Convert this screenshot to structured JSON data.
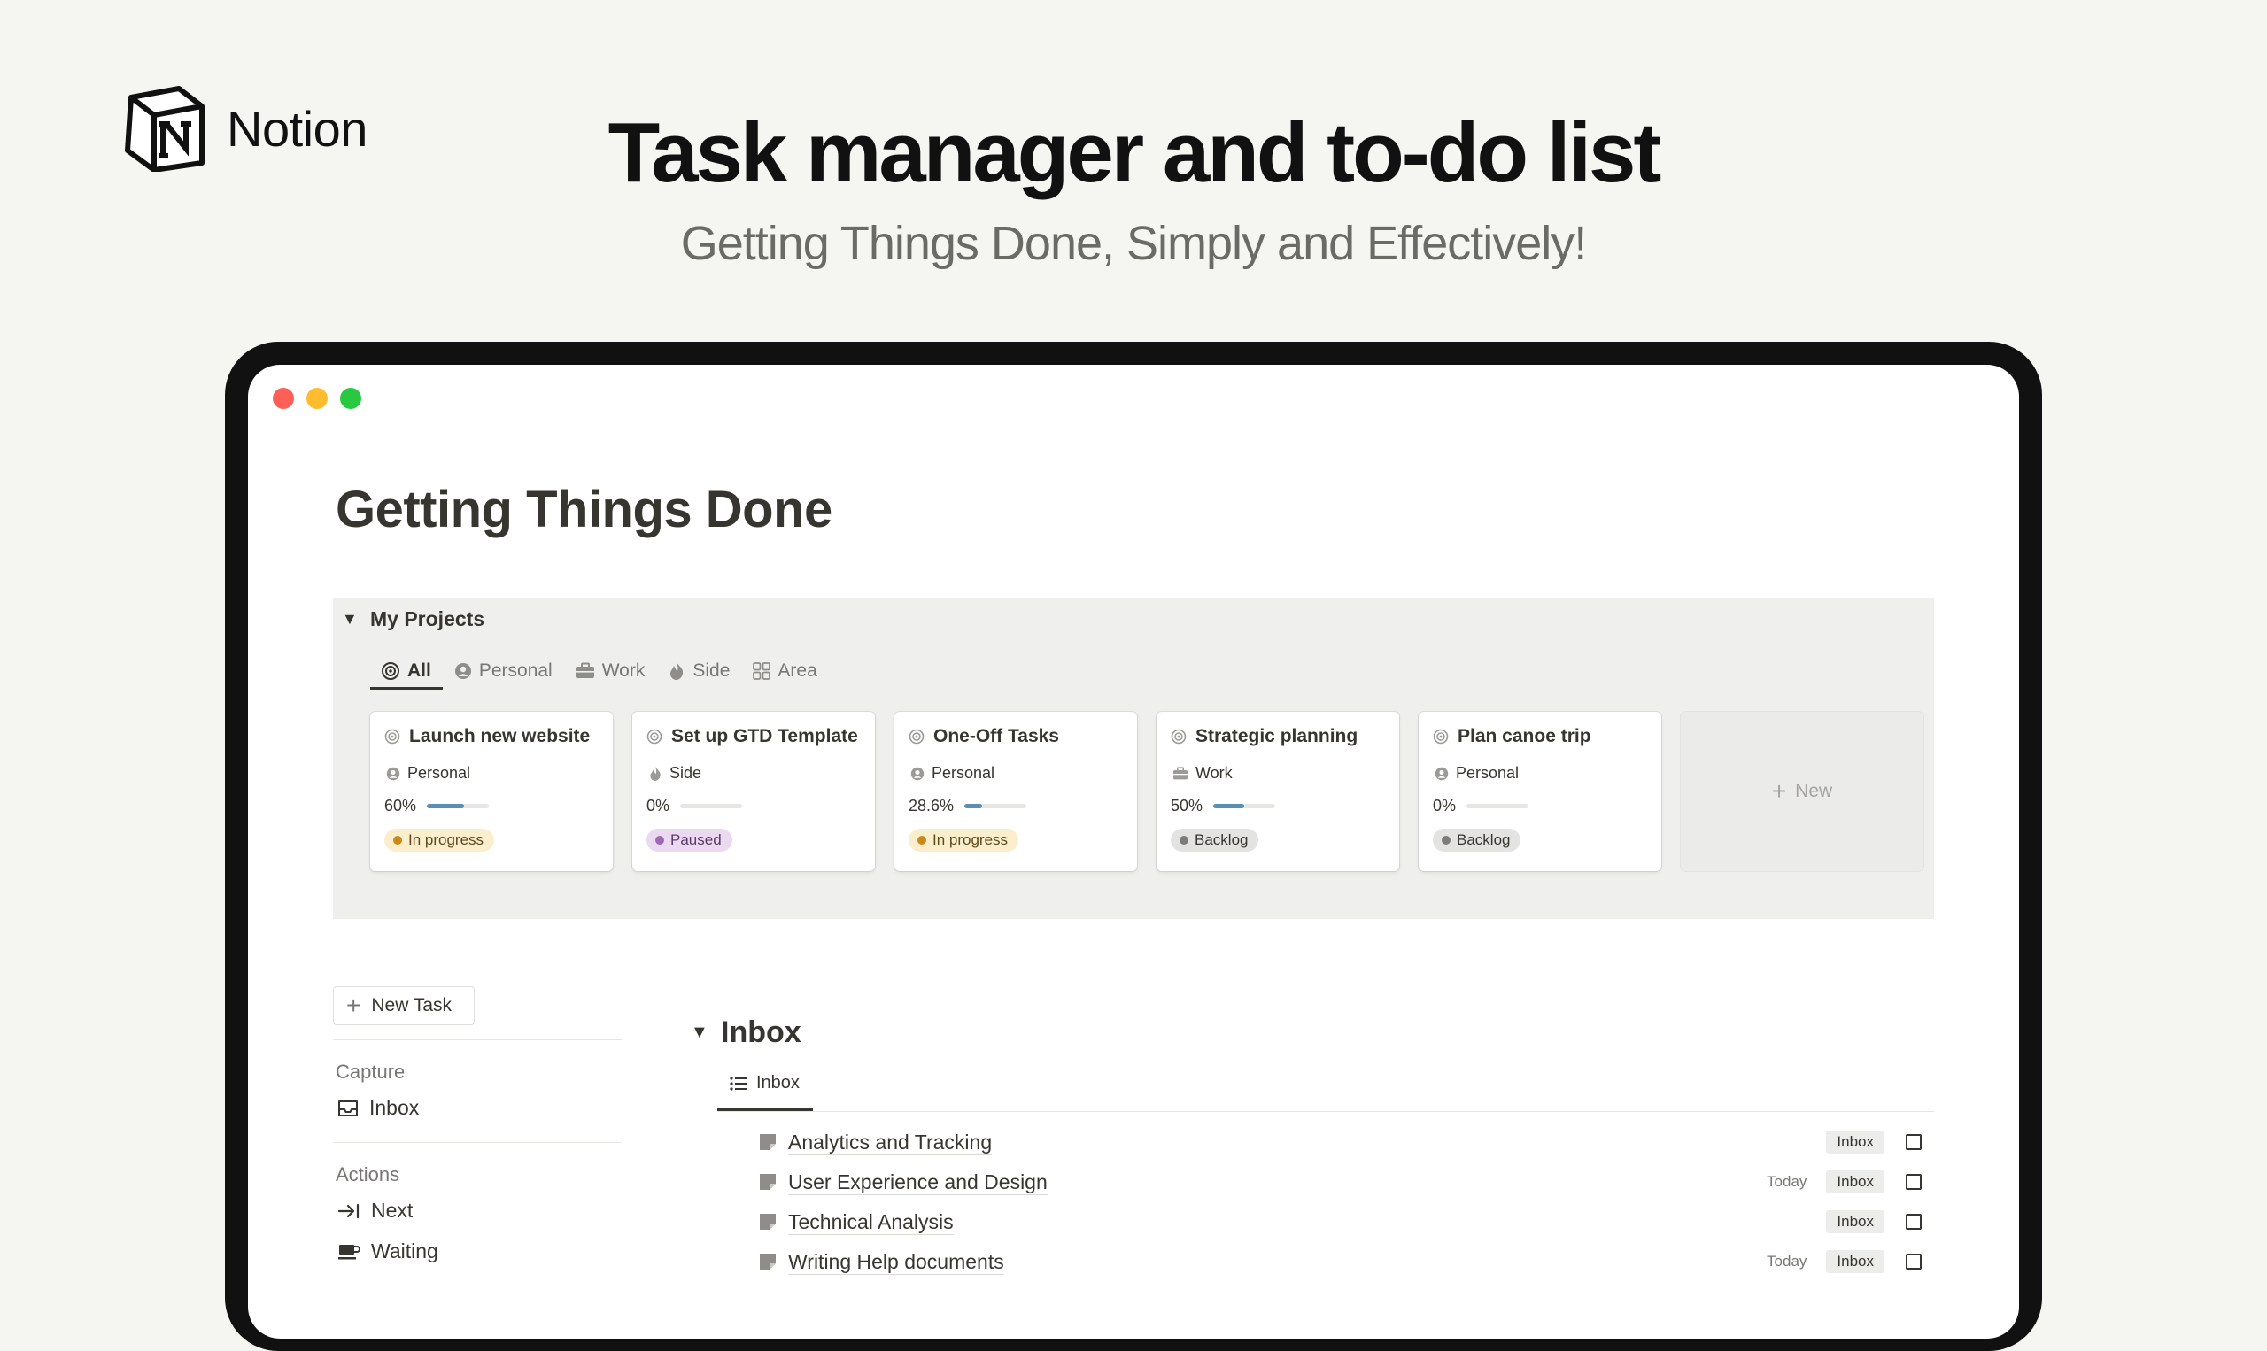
{
  "brand": {
    "name": "Notion",
    "logo_icon": "notion-logo-icon"
  },
  "hero": {
    "title": "Task manager and to-do list",
    "subtitle": "Getting Things Done, Simply and Effectively!"
  },
  "page": {
    "title": "Getting Things Done"
  },
  "projects": {
    "label": "My Projects",
    "tabs": [
      {
        "label": "All",
        "icon": "target-icon",
        "active": true
      },
      {
        "label": "Personal",
        "icon": "person-icon",
        "active": false
      },
      {
        "label": "Work",
        "icon": "briefcase-icon",
        "active": false
      },
      {
        "label": "Side",
        "icon": "flame-icon",
        "active": false
      },
      {
        "label": "Area",
        "icon": "grid-icon",
        "active": false
      }
    ],
    "cards": [
      {
        "title": "Launch new website",
        "area": "Personal",
        "progress_label": "60%",
        "progress": 0.6,
        "status": "In progress"
      },
      {
        "title": "Set up GTD Template",
        "area": "Side",
        "progress_label": "0%",
        "progress": 0.0,
        "status": "Paused"
      },
      {
        "title": "One-Off Tasks",
        "area": "Personal",
        "progress_label": "28.6%",
        "progress": 0.286,
        "status": "In progress"
      },
      {
        "title": "Strategic planning",
        "area": "Work",
        "progress_label": "50%",
        "progress": 0.5,
        "status": "Backlog"
      },
      {
        "title": "Plan canoe trip",
        "area": "Personal",
        "progress_label": "0%",
        "progress": 0.0,
        "status": "Backlog"
      }
    ],
    "new_label": "New"
  },
  "sidebar": {
    "new_task_label": "New Task",
    "capture_heading": "Capture",
    "inbox_label": "Inbox",
    "actions_heading": "Actions",
    "next_label": "Next",
    "waiting_label": "Waiting"
  },
  "inbox": {
    "title": "Inbox",
    "view_label": "Inbox",
    "tasks": [
      {
        "name": "Analytics and Tracking",
        "date": "",
        "tag": "Inbox"
      },
      {
        "name": "User Experience and Design",
        "date": "Today",
        "tag": "Inbox"
      },
      {
        "name": "Technical Analysis",
        "date": "",
        "tag": "Inbox"
      },
      {
        "name": "Writing Help documents",
        "date": "Today",
        "tag": "Inbox"
      }
    ]
  },
  "colors": {
    "background": "#f5f5f1",
    "frame": "#111111",
    "progress_bar": "#5a8fb2",
    "in_progress_bg": "#fbeecc",
    "paused_bg": "#ead9f0",
    "backlog_bg": "#e3e3e1"
  }
}
